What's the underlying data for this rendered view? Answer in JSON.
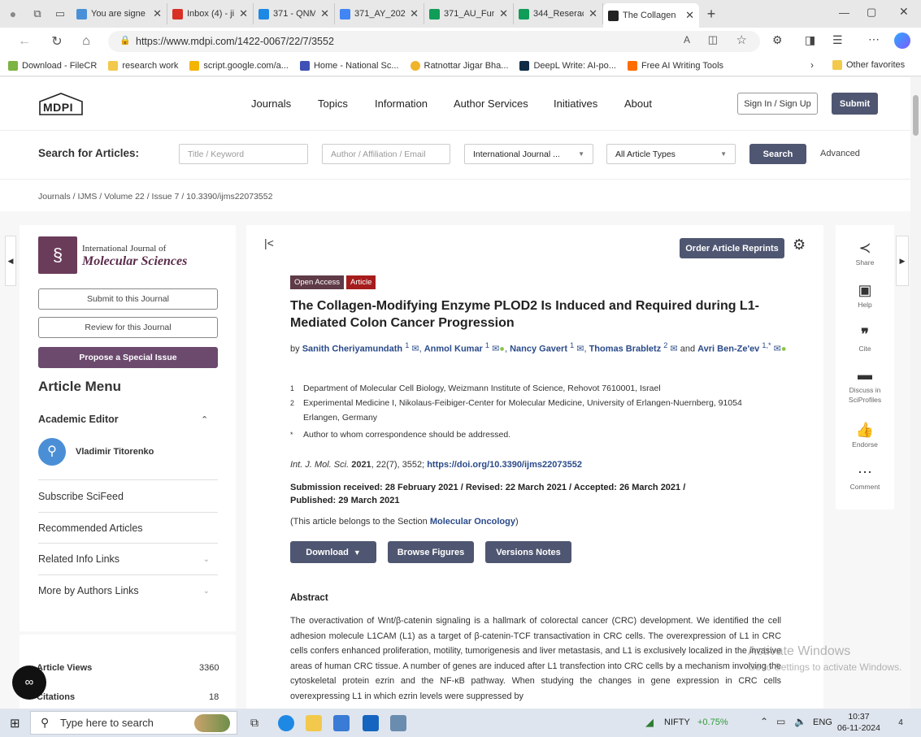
{
  "browser": {
    "tabs": [
      {
        "label": "You are signe",
        "color": "#4a90d9"
      },
      {
        "label": "Inbox (4) - jig",
        "color": "#d93025"
      },
      {
        "label": "371 - QNM -",
        "color": "#1e88e5"
      },
      {
        "label": "371_AY_2022",
        "color": "#4285f4"
      },
      {
        "label": "371_AU_Func",
        "color": "#0f9d58"
      },
      {
        "label": "344_Reserach",
        "color": "#0f9d58"
      },
      {
        "label": "The Collagen",
        "color": "#222222"
      }
    ],
    "new_tab": "+",
    "url": "https://www.mdpi.com/1422-0067/22/7/3552",
    "bookmarks": [
      {
        "label": "Download - FileCR",
        "color": "#7cb342"
      },
      {
        "label": "research work",
        "color": "#f2c94c"
      },
      {
        "label": "script.google.com/a...",
        "color": "#f4b400"
      },
      {
        "label": "Home - National Sc...",
        "color": "#3f51b5"
      },
      {
        "label": "Ratnottar Jigar Bha...",
        "color": "#f0b429"
      },
      {
        "label": "DeepL Write: AI-po...",
        "color": "#0f2b46"
      },
      {
        "label": "Free AI Writing Tools",
        "color": "#ff6d00"
      }
    ],
    "other_favorites": "Other favorites"
  },
  "site": {
    "logo": "MDPI",
    "nav": [
      "Journals",
      "Topics",
      "Information",
      "Author Services",
      "Initiatives",
      "About"
    ],
    "signin": "Sign In / Sign Up",
    "submit": "Submit",
    "search_label": "Search for Articles:",
    "search_title_placeholder": "Title / Keyword",
    "search_author_placeholder": "Author / Affiliation / Email",
    "journal_select": "International Journal ...",
    "type_select": "All Article Types",
    "search_button": "Search",
    "advanced": "Advanced",
    "breadcrumb": [
      "Journals",
      "IJMS",
      "Volume 22",
      "Issue 7",
      "10.3390/ijms22073552"
    ]
  },
  "sidebar": {
    "journal_line1": "International Journal of",
    "journal_line2": "Molecular Sciences",
    "submit_journal": "Submit to this Journal",
    "review_journal": "Review for this Journal",
    "propose_issue": "Propose a Special Issue",
    "article_menu": "Article Menu",
    "academic_editor": "Academic Editor",
    "editor_name": "Vladimir Titorenko",
    "links": [
      "Subscribe SciFeed",
      "Recommended Articles",
      "Related Info Links",
      "More by Authors Links"
    ],
    "metrics": [
      {
        "label": "Article Views",
        "value": "3360"
      },
      {
        "label": "Citations",
        "value": "18"
      }
    ]
  },
  "article": {
    "order_reprints": "Order Article Reprints",
    "badges": [
      "Open Access",
      "Article"
    ],
    "title": "The Collagen-Modifying Enzyme PLOD2 Is Induced and Required during L1-Mediated Colon Cancer Progression",
    "by": "by",
    "authors_line1": [
      {
        "name": "Sanith Cheriyamundath",
        "sup": "1"
      },
      {
        "name": "Anmol Kumar",
        "sup": "1"
      },
      {
        "name": "Nancy Gavert",
        "sup": "1"
      },
      {
        "name": "Thomas Brabletz",
        "sup": "2"
      }
    ],
    "and": "and",
    "last_author": "Avri Ben-Ze'ev",
    "last_author_sup": "1,*",
    "affiliations": [
      {
        "mark": "1",
        "text": "Department of Molecular Cell Biology, Weizmann Institute of Science, Rehovot 7610001, Israel"
      },
      {
        "mark": "2",
        "text": "Experimental Medicine I, Nikolaus-Feibiger-Center for Molecular Medicine, University of Erlangen-Nuernberg, 91054 Erlangen, Germany"
      },
      {
        "mark": "*",
        "text": "Author to whom correspondence should be addressed."
      }
    ],
    "citation_journal": "Int. J. Mol. Sci.",
    "citation_year": "2021",
    "citation_rest": ", 22(7), 3552;",
    "doi": "https://doi.org/10.3390/ijms22073552",
    "dates_line1": "Submission received: 28 February 2021 / Revised: 22 March 2021 / Accepted: 26 March 2021 /",
    "dates_line2": "Published: 29 March 2021",
    "section_prefix": "(This article belongs to the Section ",
    "section_name": "Molecular Oncology",
    "section_suffix": ")",
    "download": "Download",
    "browse_figures": "Browse Figures",
    "versions_notes": "Versions Notes",
    "abstract_heading": "Abstract",
    "abstract": "The overactivation of Wnt/β-catenin signaling is a hallmark of colorectal cancer (CRC) development. We identified the cell adhesion molecule L1CAM (L1) as a target of β-catenin-TCF transactivation in CRC cells. The overexpression of L1 in CRC cells confers enhanced proliferation, motility, tumorigenesis and liver metastasis, and L1 is exclusively localized in the invasive areas of human CRC tissue. A number of genes are induced after L1 transfection into CRC cells by a mechanism involving the cytoskeletal protein ezrin and the NF-κB pathway. When studying the changes in gene expression in CRC cells overexpressing L1 in which ezrin levels were suppressed by"
  },
  "tools": [
    {
      "label": "Share",
      "icon": "share-icon"
    },
    {
      "label": "Help",
      "icon": "help-icon"
    },
    {
      "label": "Cite",
      "icon": "quote-icon"
    },
    {
      "label": "Discuss in SciProfiles",
      "icon": "discuss-icon"
    },
    {
      "label": "Endorse",
      "icon": "thumbs-up-icon"
    },
    {
      "label": "Comment",
      "icon": "comment-icon"
    }
  ],
  "watermark": {
    "line1": "Activate Windows",
    "line2": "Go to Settings to activate Windows."
  },
  "taskbar": {
    "search_placeholder": "Type here to search",
    "stock_name": "NIFTY",
    "stock_change": "+0.75%",
    "lang": "ENG",
    "time": "10:37",
    "date": "06-11-2024",
    "notifications": "4"
  },
  "colors": {
    "mdpi_dark": "#4f5671",
    "propose": "#6b4a6e",
    "open_access": "#5f3a47",
    "article_badge": "#a61c1c",
    "link": "#2a4a8a"
  }
}
